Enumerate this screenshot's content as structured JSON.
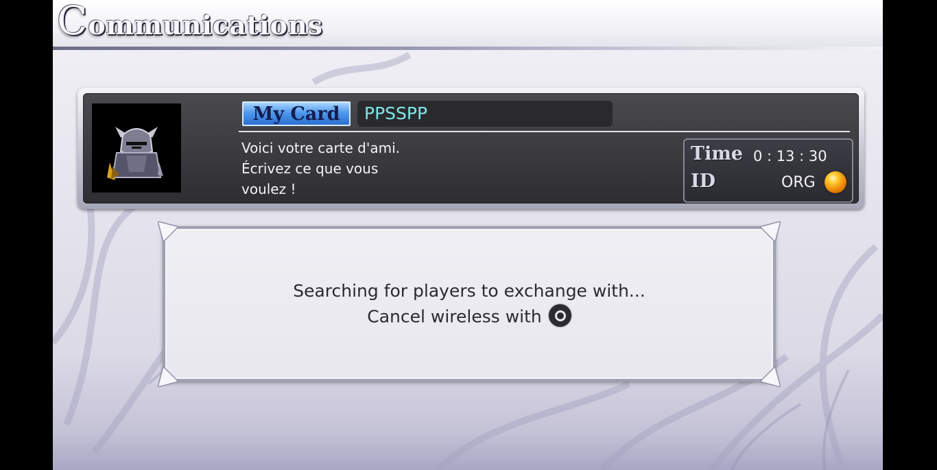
{
  "screen": {
    "title": "Communications",
    "title_initial": "C",
    "title_rest": "ommunications"
  },
  "card": {
    "tab_label": "My Card",
    "player_name": "PPSSPP",
    "message_lines": [
      "Voici votre carte d'ami.",
      "Écrivez ce que vous",
      "voulez !"
    ],
    "time_label": "Time",
    "time_value": "0 : 13 : 30",
    "id_label": "ID",
    "id_value": "ORG",
    "avatar_icon": "armored-knight-icon",
    "orb_icon": "orange-orb-icon"
  },
  "dialog": {
    "line1": "Searching for players to exchange with...",
    "line2": "Cancel wireless with",
    "cancel_button_icon": "circle-button-icon"
  },
  "colors": {
    "name_text": "#7ee7ea",
    "tab_blue": "#4e99ec",
    "card_bg": "#3b3b3f",
    "dialog_bg": "#eceaf1"
  }
}
